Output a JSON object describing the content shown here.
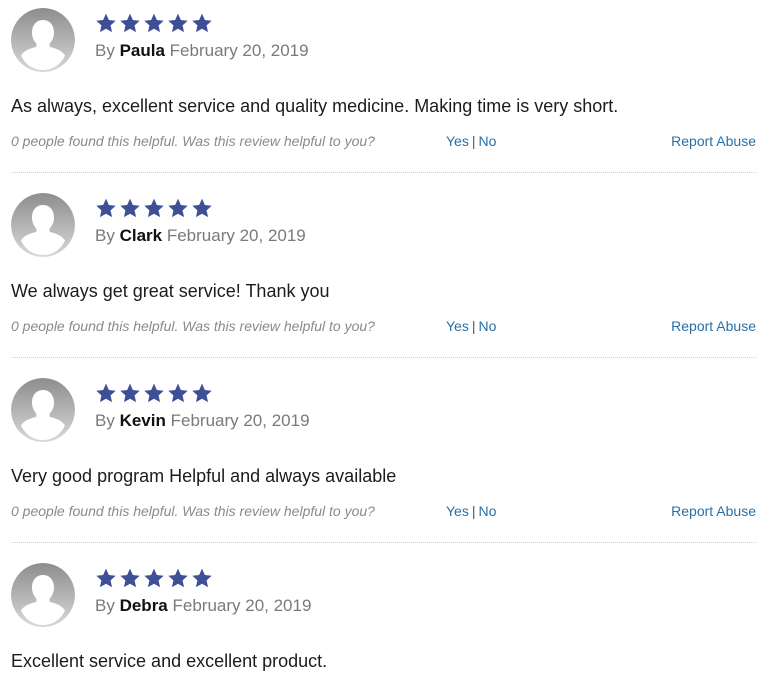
{
  "stars_color": "#3e4f96",
  "link_color": "#2a6fa6",
  "reviews": [
    {
      "rating": 5,
      "by": "By",
      "name": "Paula",
      "date": "February 20, 2019",
      "text": "As always, excellent service and quality medicine. Making time is very short.",
      "helpful": "0 people found this helpful. Was this review helpful to you?",
      "yes": "Yes",
      "sep": "|",
      "no": "No",
      "report": "Report Abuse"
    },
    {
      "rating": 5,
      "by": "By",
      "name": "Clark",
      "date": "February 20, 2019",
      "text": "We always get great service! Thank you",
      "helpful": "0 people found this helpful. Was this review helpful to you?",
      "yes": "Yes",
      "sep": "|",
      "no": "No",
      "report": "Report Abuse"
    },
    {
      "rating": 5,
      "by": "By",
      "name": "Kevin",
      "date": "February 20, 2019",
      "text": "Very good program Helpful and always available",
      "helpful": "0 people found this helpful. Was this review helpful to you?",
      "yes": "Yes",
      "sep": "|",
      "no": "No",
      "report": "Report Abuse"
    },
    {
      "rating": 5,
      "by": "By",
      "name": "Debra",
      "date": "February 20, 2019",
      "text": "Excellent service and excellent product."
    }
  ]
}
